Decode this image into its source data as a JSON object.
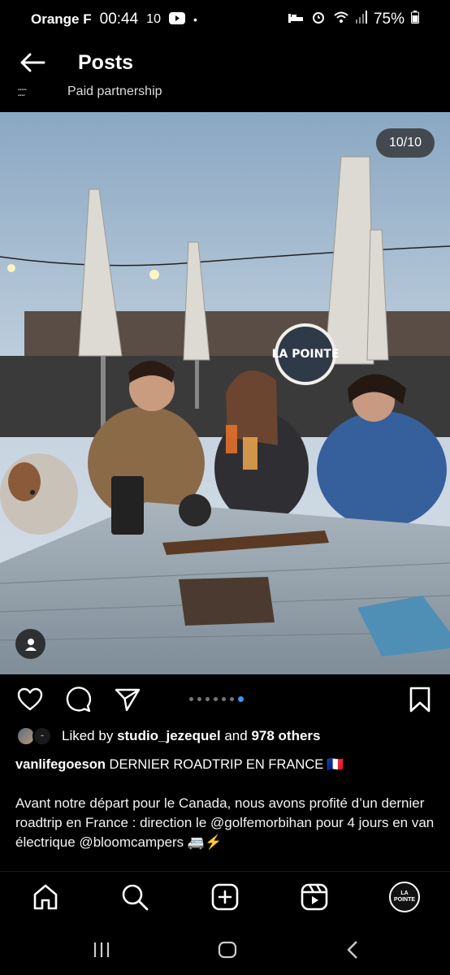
{
  "status_bar": {
    "carrier": "Orange F",
    "time": "00:44",
    "extra": "10",
    "battery": "75%"
  },
  "header": {
    "title": "Posts",
    "partnership_label": "Paid partnership"
  },
  "post": {
    "image_counter": "10/10",
    "carousel_count": 7,
    "carousel_active_index": 6,
    "sign_text": "LA POINTE",
    "likes": {
      "prefix": "Liked by",
      "user": "studio_jezequel",
      "and": "and",
      "others": "978 others"
    },
    "caption": {
      "username": "vanlifegoeson",
      "title": "DERNIER ROADTRIP EN FRANCE 🇫🇷",
      "body": "Avant notre départ pour le Canada, nous avons profité d’un dernier roadtrip en France : direction le @golfemorbihan pour 4 jours en van électrique @bloomcampers 🚐⚡"
    }
  },
  "bottom_nav": {
    "items": [
      "home-icon",
      "search-icon",
      "create-icon",
      "reels-icon",
      "profile-avatar"
    ],
    "profile_text_line1": "LA",
    "profile_text_line2": "POINTE"
  },
  "colors": {
    "background": "#000000",
    "accent": "#3897f0"
  }
}
